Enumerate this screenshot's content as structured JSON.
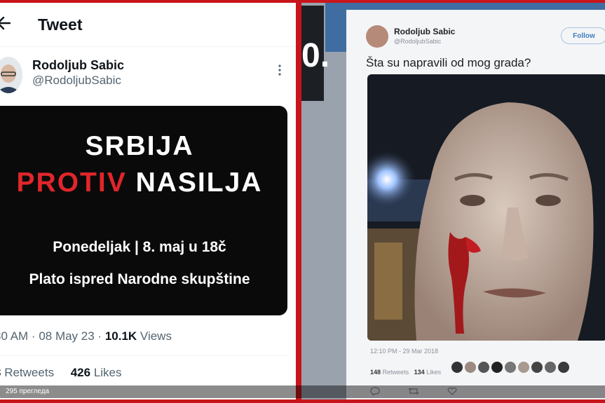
{
  "left_tweet": {
    "header_title": "Tweet",
    "author_name": "Rodoljub Sabic",
    "author_handle": "@RodoljubSabic",
    "banner": {
      "line1": "SRBIJA",
      "line2_red": "PROTIV",
      "line2_white": "NASILJA",
      "line3": "Ponedeljak | 8. maj u 18č",
      "line4": "Plato ispred Narodne skupštine",
      "red_color": "#e0262b"
    },
    "meta": {
      "time": "30 AM",
      "date": "08 May 23",
      "views_count": "10.1K",
      "views_label": "Views"
    },
    "stats": {
      "retweets_count": "3",
      "retweets_label": "Retweets",
      "likes_count": "426",
      "likes_label": "Likes"
    }
  },
  "right_tweet": {
    "author_name": "Rodoljub Sabic",
    "author_handle": "@RodoljubSabic",
    "follow_label": "Follow",
    "text": "Šta su napravili od mog grada?",
    "timestamp": "12:10 PM - 29 Mar 2018",
    "retweets_count": "148",
    "retweets_label": "Retweets",
    "likes_count": "134",
    "likes_label": "Likes"
  },
  "tv_overlay_glyph": "0.",
  "views_overlay": "295 прегледа",
  "colors": {
    "frame_red": "#c8151b",
    "twitter_blue": "#3f7cbd",
    "text_gray": "#536471"
  }
}
